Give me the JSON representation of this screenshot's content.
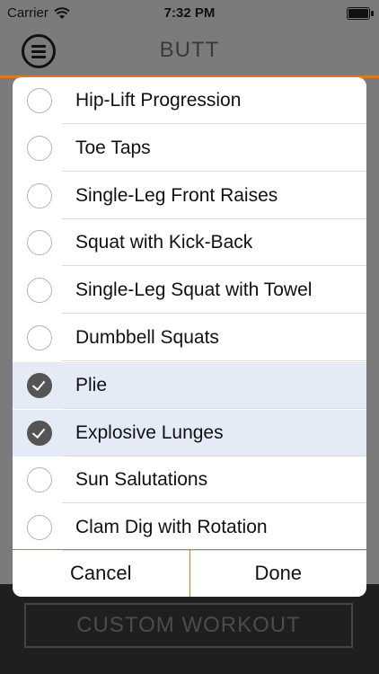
{
  "status_bar": {
    "carrier": "Carrier",
    "time": "7:32 PM",
    "icons": [
      "wifi-icon",
      "battery-icon"
    ]
  },
  "nav": {
    "title": "BUTT",
    "menu_icon": "hamburger-menu-icon"
  },
  "exercises": [
    {
      "label": "Hip-Lift Progression",
      "selected": false
    },
    {
      "label": "Toe Taps",
      "selected": false
    },
    {
      "label": "Single-Leg Front Raises",
      "selected": false
    },
    {
      "label": "Squat with Kick-Back",
      "selected": false
    },
    {
      "label": "Single-Leg Squat with Towel",
      "selected": false
    },
    {
      "label": "Dumbbell Squats",
      "selected": false
    },
    {
      "label": "Plie",
      "selected": true
    },
    {
      "label": "Explosive Lunges",
      "selected": true
    },
    {
      "label": "Sun Salutations",
      "selected": false
    },
    {
      "label": "Clam Dig with Rotation",
      "selected": false
    }
  ],
  "dialog": {
    "cancel_label": "Cancel",
    "done_label": "Done"
  },
  "bottom": {
    "custom_workout_label": "CUSTOM WORKOUT"
  },
  "colors": {
    "accent": "#d77a29",
    "selected_row": "#e4ebf7",
    "check_fill": "#555555"
  }
}
